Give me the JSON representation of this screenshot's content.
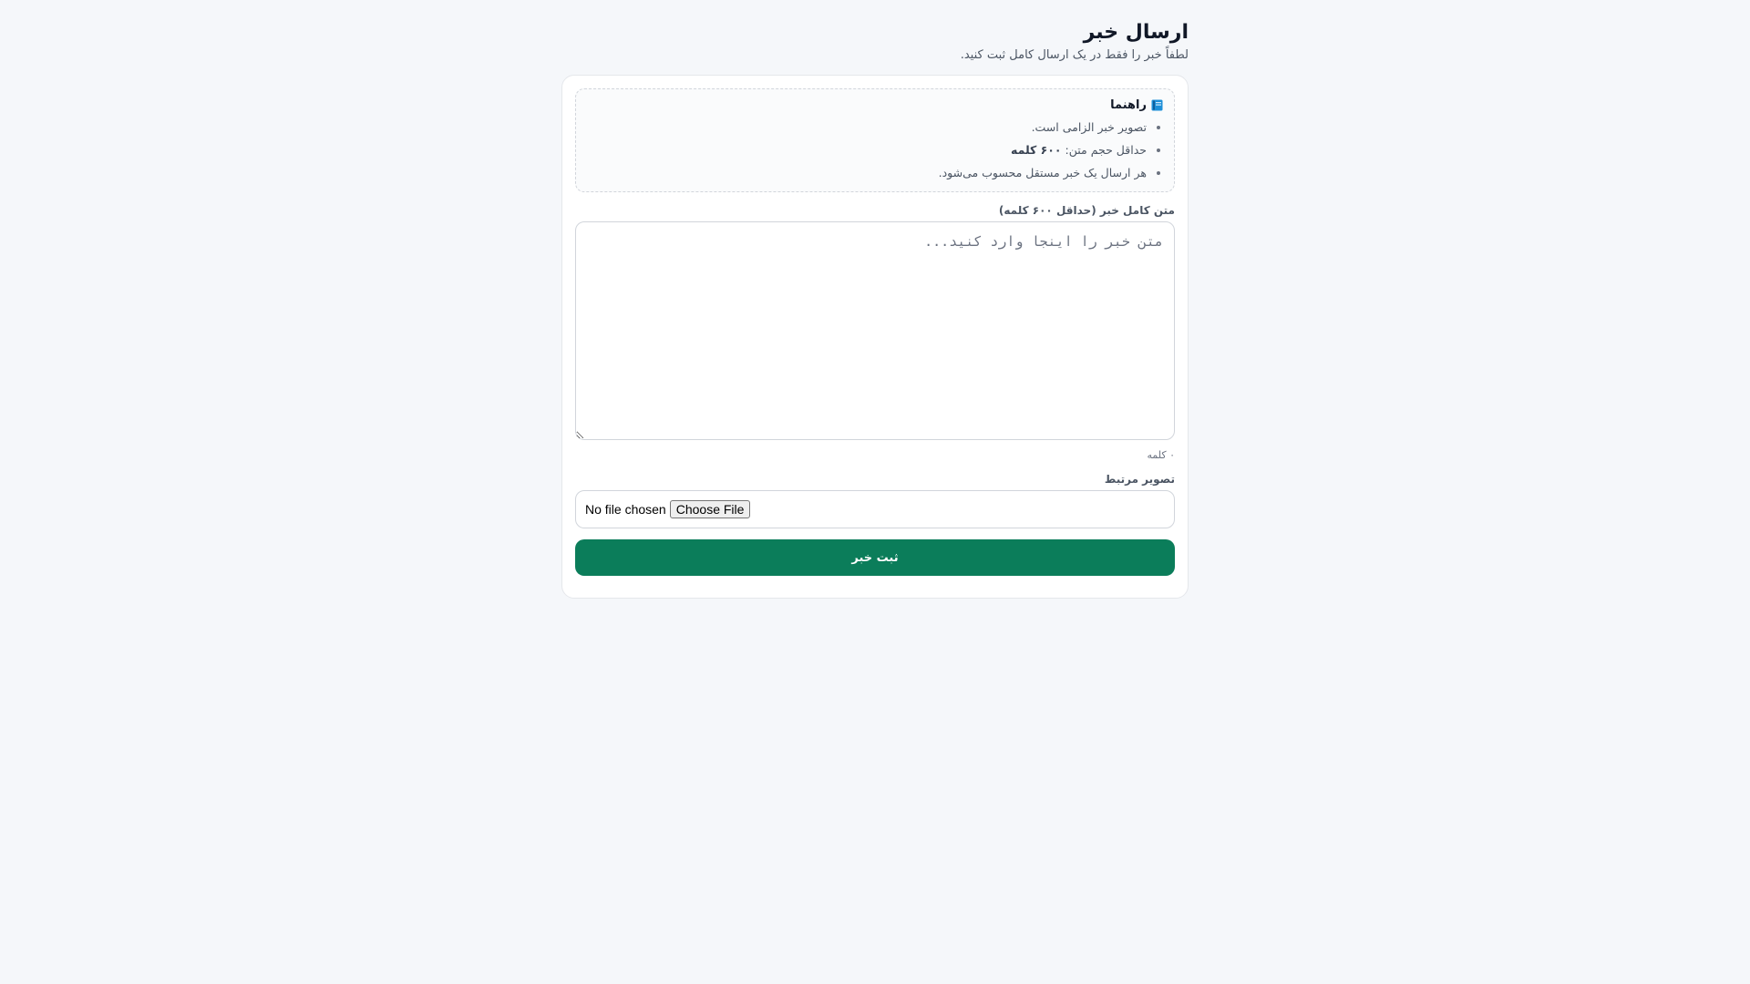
{
  "header": {
    "title": "ارسال خبر",
    "subtitle": "لطفاً خبر را فقط در یک ارسال کامل ثبت کنید."
  },
  "guide": {
    "icon": "blue-book-icon",
    "title": "راهنما",
    "items": [
      {
        "text": "تصویر خبر الزامی است.",
        "bold": ""
      },
      {
        "text": "حداقل حجم متن: ",
        "bold": "۶۰۰ کلمه"
      },
      {
        "text": "هر ارسال یک خبر مستقل محسوب می‌شود.",
        "bold": ""
      }
    ]
  },
  "text_field": {
    "label": "متن کامل خبر (حداقل ۶۰۰ کلمه)",
    "placeholder": "متن خبر را اینجا وارد کنید...",
    "value": "",
    "word_count": "۰ کلمه"
  },
  "image_field": {
    "label": "تصویر مرتبط",
    "button_label": "Choose File",
    "status": "No file chosen"
  },
  "submit": {
    "label": "ثبت خبر"
  },
  "colors": {
    "background": "#f5f7fa",
    "submit": "#0b7d5a",
    "book_icon": "#1d8fd8"
  }
}
